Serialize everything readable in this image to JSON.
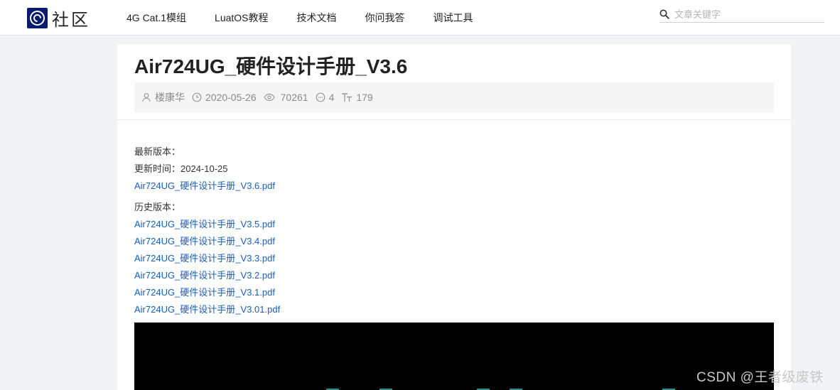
{
  "header": {
    "logo_text": "社区",
    "nav": [
      "4G Cat.1模组",
      "LuatOS教程",
      "技术文档",
      "你问我答",
      "调试工具"
    ],
    "search": {
      "placeholder": "文章关键字",
      "value": ""
    }
  },
  "article": {
    "title": "Air724UG_硬件设计手册_V3.6",
    "meta": {
      "author": "楼康华",
      "date": "2020-05-26",
      "views": "70261",
      "comments": "4",
      "words": "179"
    },
    "latest_label": "最新版本：",
    "updated_label": "更新时间：2024-10-25",
    "latest_file": "Air724UG_硬件设计手册_V3.6.pdf",
    "history_label": "历史版本：",
    "history_files": [
      "Air724UG_硬件设计手册_V3.5.pdf",
      "Air724UG_硬件设计手册_V3.4.pdf",
      "Air724UG_硬件设计手册_V3.3.pdf",
      "Air724UG_硬件设计手册_V3.2.pdf",
      "Air724UG_硬件设计手册_V3.1.pdf",
      "Air724UG_硬件设计手册_V3.01.pdf"
    ]
  },
  "watermark": "CSDN @王者级废铁",
  "colors": {
    "link": "#1a5fb4",
    "logo_bg": "#0c1a6e",
    "page_bg": "#f2f3f5"
  }
}
